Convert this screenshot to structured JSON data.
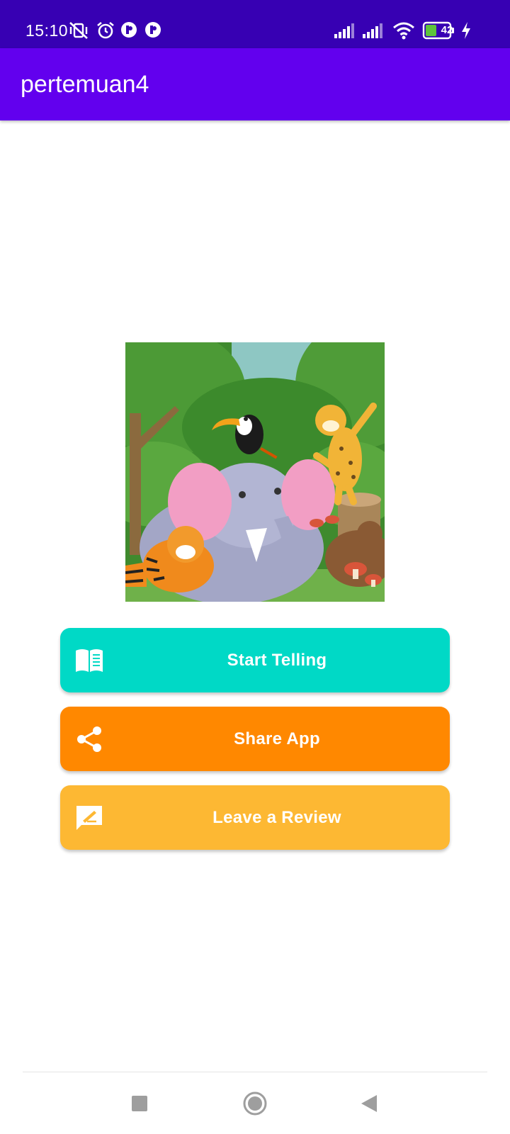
{
  "status_bar": {
    "time": "15:10",
    "battery_level": "42",
    "icons": [
      "vibrate-off-icon",
      "alarm-icon",
      "app-notification-icon",
      "app-notification-icon",
      "signal-icon",
      "signal-icon",
      "wifi-icon",
      "battery-icon",
      "charging-icon"
    ]
  },
  "app_bar": {
    "title": "pertemuan4"
  },
  "hero": {
    "image": "jungle-animals-illustration"
  },
  "buttons": [
    {
      "label": "Start Telling",
      "icon": "book-icon",
      "color": "#00d9c6"
    },
    {
      "label": "Share App",
      "icon": "share-icon",
      "color": "#ff8800"
    },
    {
      "label": "Leave a Review",
      "icon": "review-icon",
      "color": "#fdb833"
    }
  ],
  "nav_bar": {
    "icons": [
      "recents-square-icon",
      "home-circle-icon",
      "back-triangle-icon"
    ]
  },
  "colors": {
    "status_bar": "#3700b3",
    "app_bar": "#6200ee"
  }
}
